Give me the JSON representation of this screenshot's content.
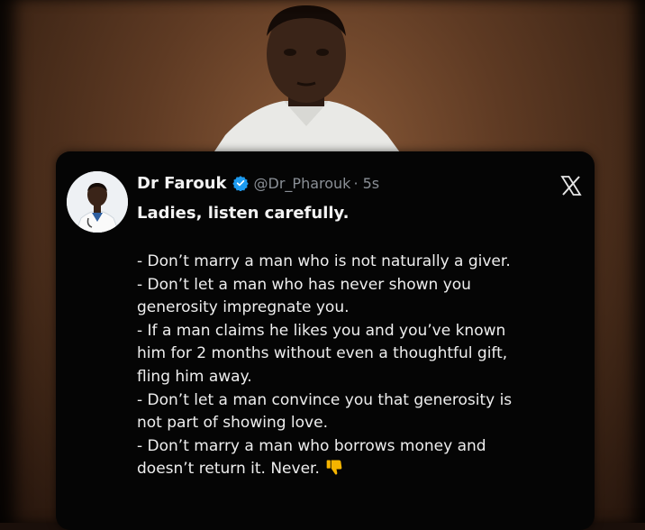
{
  "tweet": {
    "author_name": "Dr Farouk",
    "handle": "@Dr_Pharouk",
    "time": "· 5s",
    "headline": "Ladies, listen carefully.",
    "lines": [
      "- Don’t marry a man who is not naturally a giver.",
      "- Don’t let a man who has never shown you",
      "generosity impregnate you.",
      "- If a man claims he likes you and you’ve known",
      "him for 2 months without even a thoughtful gift,",
      "fling him away.",
      "- Don’t let a man convince you that generosity is",
      "not part of showing love.",
      "- Don’t marry a man who borrows money and",
      "doesn’t return it. Never."
    ],
    "trailing_emoji": "thumbs-down-icon"
  },
  "icons": {
    "verified": "verified-badge-icon",
    "close": "x-logo-icon"
  },
  "colors": {
    "card_bg": "#050505",
    "verified_blue": "#1d9bf0",
    "handle_gray": "#8a8f96",
    "emoji_yellow": "#f5b400"
  }
}
